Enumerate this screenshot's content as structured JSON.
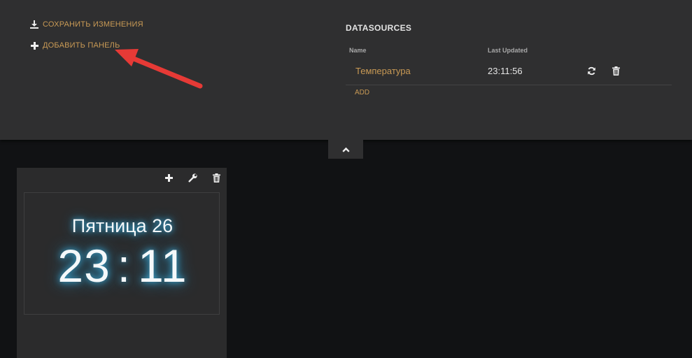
{
  "toolbar": {
    "save_label": "СОХРАНИТЬ ИЗМЕНЕНИЯ",
    "add_pane_label": "ДОБАВИТЬ ПАНЕЛЬ"
  },
  "datasources": {
    "title": "DATASOURCES",
    "columns": {
      "name": "Name",
      "last_updated": "Last Updated"
    },
    "rows": [
      {
        "name": "Температура",
        "last_updated": "23:11:56"
      }
    ],
    "add_label": "ADD"
  },
  "pane": {
    "widget": {
      "day": "Пятница 26",
      "hours": "23",
      "separator": ":",
      "minutes": "11"
    }
  },
  "icons": {
    "save": "download-icon",
    "add_pane": "plus-icon",
    "refresh": "refresh-icon",
    "trash": "trash-icon",
    "toggle": "chevron-up-icon",
    "pane_add": "plus-icon",
    "pane_settings": "wrench-icon",
    "pane_delete": "trash-icon"
  },
  "colors": {
    "accent": "#c99a55",
    "panel_bg": "#2f2f30",
    "page_bg": "#111214",
    "glow": "#3fb6e6",
    "annotation": "#e63a36"
  }
}
